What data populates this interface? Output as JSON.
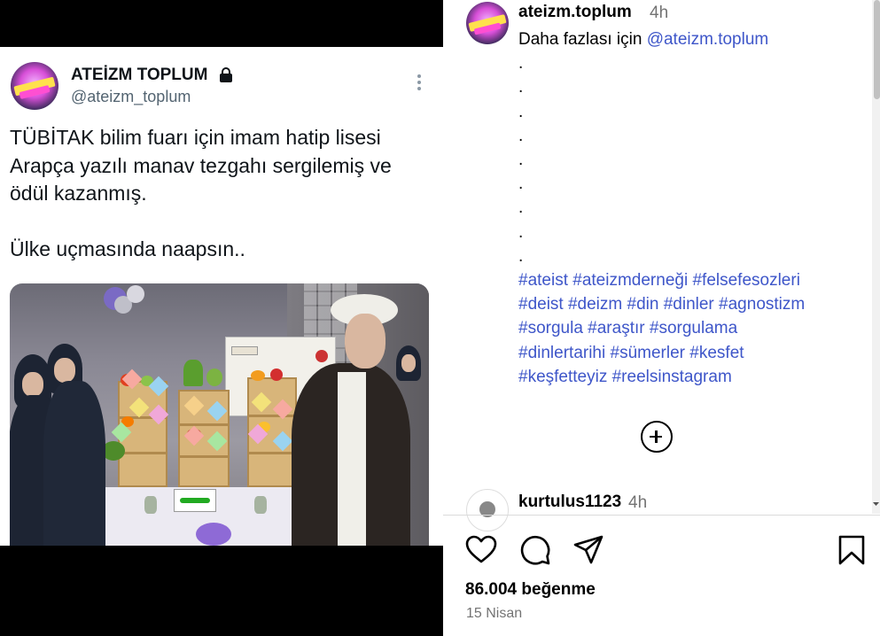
{
  "tweet": {
    "display_name": "ATEİZM TOPLUM",
    "handle": "@ateizm_toplum",
    "text_lines": [
      "TÜBİTAK bilim fuarı için imam hatip lisesi",
      "Arapça yazılı manav tezgahı sergilemiş ve",
      "ödül kazanmış."
    ],
    "text_second_paragraph": "Ülke uçmasında naapsın.."
  },
  "post": {
    "username": "ateizm.toplum",
    "time": "4h",
    "caption_prefix": "Daha fazlası için",
    "caption_mention": "@ateizm.toplum",
    "dots": [
      ".",
      ".",
      ".",
      ".",
      ".",
      ".",
      ".",
      ".",
      "."
    ],
    "hashtags": [
      "#ateist",
      "#ateizmderneği",
      "#felsefesozleri",
      "#deist",
      "#deizm",
      "#din",
      "#dinler",
      "#agnostizm",
      "#sorgula",
      "#araştır",
      "#sorgulama",
      "#dinlertarihi",
      "#sümerler",
      "#kesfet",
      "#keşfetteyiz",
      "#reelsinstagram"
    ]
  },
  "comment": {
    "username": "kurtulus1123",
    "time": "4h"
  },
  "stats": {
    "likes": "86.004 beğenme",
    "date": "15 Nisan"
  },
  "icons": [
    "lock-icon",
    "more-icon",
    "add-circle-icon",
    "heart-icon",
    "comment-icon",
    "share-icon",
    "save-icon"
  ]
}
